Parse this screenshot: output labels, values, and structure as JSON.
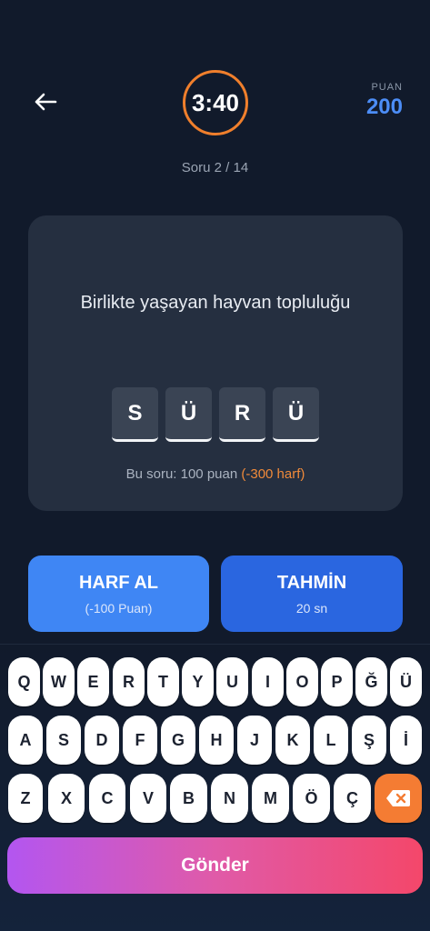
{
  "header": {
    "timer": "3:40",
    "score_label": "PUAN",
    "score_value": "200",
    "progress": "Soru 2 / 14"
  },
  "card": {
    "question": "Birlikte yaşayan hayvan topluluğu",
    "tiles": [
      "S",
      "Ü",
      "R",
      "Ü"
    ],
    "info_main": "Bu soru: 100 puan ",
    "info_penalty": "(-300 harf)"
  },
  "actions": {
    "harf_title": "HARF AL",
    "harf_sub": "(-100 Puan)",
    "tahmin_title": "TAHMİN",
    "tahmin_sub": "20 sn"
  },
  "keyboard": {
    "row1": [
      "Q",
      "W",
      "E",
      "R",
      "T",
      "Y",
      "U",
      "I",
      "O",
      "P",
      "Ğ",
      "Ü"
    ],
    "row2": [
      "A",
      "S",
      "D",
      "F",
      "G",
      "H",
      "J",
      "K",
      "L",
      "Ş",
      "İ"
    ],
    "row3": [
      "Z",
      "X",
      "C",
      "V",
      "B",
      "N",
      "M",
      "Ö",
      "Ç"
    ],
    "backspace_icon": "backspace-icon"
  },
  "submit_label": "Gönder",
  "colors": {
    "background": "#111a2b",
    "timer_ring": "#f07f2c",
    "score": "#4c8df6",
    "penalty": "#f08a3a",
    "harf_button": "#3f86f4",
    "tahmin_button": "#2a66e0"
  }
}
